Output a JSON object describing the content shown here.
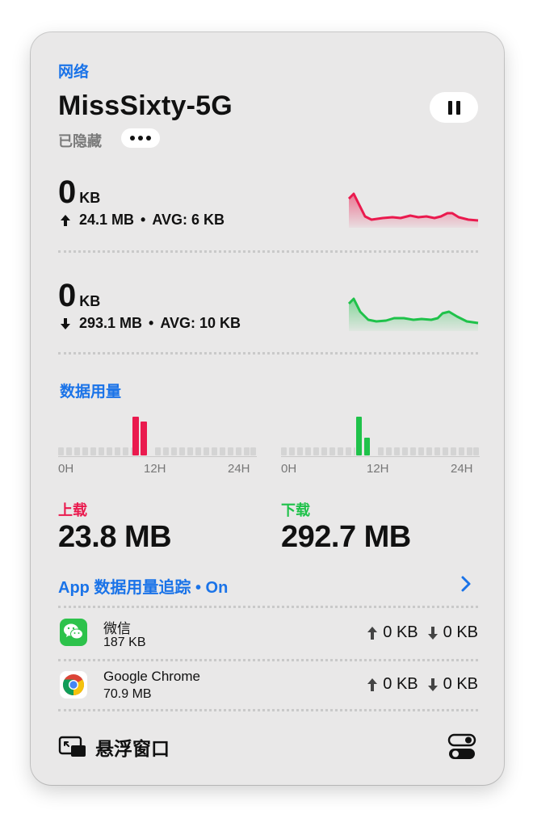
{
  "header": {
    "section": "网络",
    "ssid": "MissSixty-5G",
    "hidden_label": "已隐藏"
  },
  "upload_rate": {
    "value": "0",
    "unit": "KB",
    "total": "24.1 MB",
    "avg": "AVG: 6 KB",
    "color": "#ea1a4e"
  },
  "download_rate": {
    "value": "0",
    "unit": "KB",
    "total": "293.1 MB",
    "avg": "AVG: 10 KB",
    "color": "#1fc24a"
  },
  "usage": {
    "title": "数据用量",
    "upload_chart": {
      "ticks": [
        "0H",
        "12H",
        "24H"
      ]
    },
    "download_chart": {
      "ticks": [
        "0H",
        "12H",
        "24H"
      ]
    },
    "upload_label": "上载",
    "upload_total": "23.8 MB",
    "download_label": "下载",
    "download_total": "292.7 MB"
  },
  "tracking": {
    "label": "App 数据用量追踪 • On"
  },
  "apps": [
    {
      "name": "微信",
      "size": "187 KB",
      "up": "0 KB",
      "down": "0 KB",
      "icon": "wechat-icon"
    },
    {
      "name": "Google Chrome",
      "size": "70.9 MB",
      "up": "0 KB",
      "down": "0 KB",
      "icon": "chrome-icon"
    }
  ],
  "footer": {
    "floating_label": "悬浮窗口"
  }
}
